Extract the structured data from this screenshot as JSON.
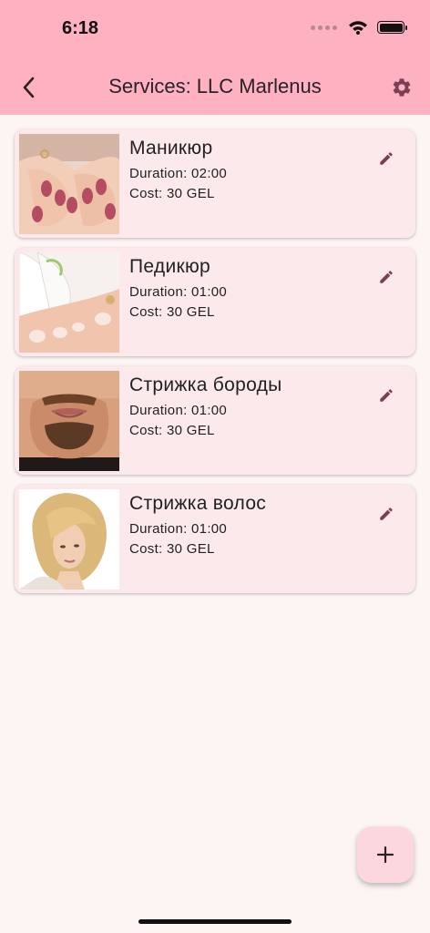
{
  "status_bar": {
    "time": "6:18"
  },
  "header": {
    "title": "Services: LLC Marlenus",
    "back_icon": "chevron-left-icon",
    "settings_icon": "gear-icon"
  },
  "services": [
    {
      "name": "Маникюр",
      "duration": "Duration: 02:00",
      "cost": "Cost: 30 GEL",
      "image": "manicure-photo"
    },
    {
      "name": "Педикюр",
      "duration": "Duration: 01:00",
      "cost": "Cost: 30 GEL",
      "image": "pedicure-photo"
    },
    {
      "name": "Стрижка бороды",
      "duration": "Duration: 01:00",
      "cost": "Cost: 30 GEL",
      "image": "beard-photo"
    },
    {
      "name": "Стрижка волос",
      "duration": "Duration: 01:00",
      "cost": "Cost: 30 GEL",
      "image": "haircut-photo"
    }
  ],
  "fab": {
    "label": "+"
  },
  "colors": {
    "header": "#fdb1c1",
    "card": "#fce9eb",
    "accent": "#7b3f56",
    "background": "#fdf4f4"
  }
}
